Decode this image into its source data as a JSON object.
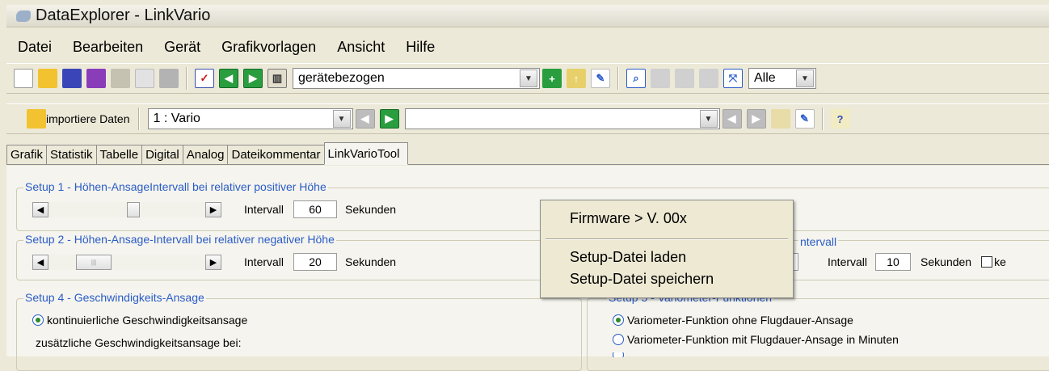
{
  "window": {
    "title": "DataExplorer  -  LinkVario"
  },
  "menu": [
    "Datei",
    "Bearbeiten",
    "Gerät",
    "Grafikvorlagen",
    "Ansicht",
    "Hilfe"
  ],
  "toolbar1": {
    "template_combo": "gerätebezogen",
    "channel_combo": "Alle"
  },
  "toolbar2": {
    "import_label": "importiere Daten",
    "record_combo": "1 : Vario",
    "record2_combo": ""
  },
  "tabs": [
    "Grafik",
    "Statistik",
    "Tabelle",
    "Digital",
    "Analog",
    "Dateikommentar",
    "LinkVarioTool"
  ],
  "active_tab": "LinkVarioTool",
  "setup1": {
    "title": "Setup 1 - Höhen-AnsageIntervall bei relativer positiver Höhe",
    "label": "Intervall",
    "value": "60",
    "unit": "Sekunden"
  },
  "setup2": {
    "title": "Setup 2 - Höhen-Ansage-Intervall bei relativer negativer Höhe",
    "label": "Intervall",
    "value": "20",
    "unit": "Sekunden"
  },
  "setup3_partial": {
    "title_visible": "ntervall",
    "label": "Intervall",
    "value": "10",
    "unit": "Sekunden",
    "checkbox_text": "ke"
  },
  "setup4": {
    "title": "Setup 4 - Geschwindigkeits-Ansage",
    "radio": "kontinuierliche Geschwindigkeitsansage",
    "text": "zusätzliche Geschwindigkeitsansage bei:"
  },
  "setup5": {
    "title": "Setup 5 - Variometer-Funktionen",
    "radio1": "Variometer-Funktion ohne Flugdauer-Ansage",
    "radio2": "Variometer-Funktion mit Flugdauer-Ansage in Minuten"
  },
  "context_menu": [
    "Firmware > V. 00x",
    "Setup-Datei laden",
    "Setup-Datei speichern"
  ],
  "colors": {
    "accent_blue": "#2a5cc7",
    "menu_bg": "#ede9d3",
    "cursor": "#e41e1e"
  }
}
